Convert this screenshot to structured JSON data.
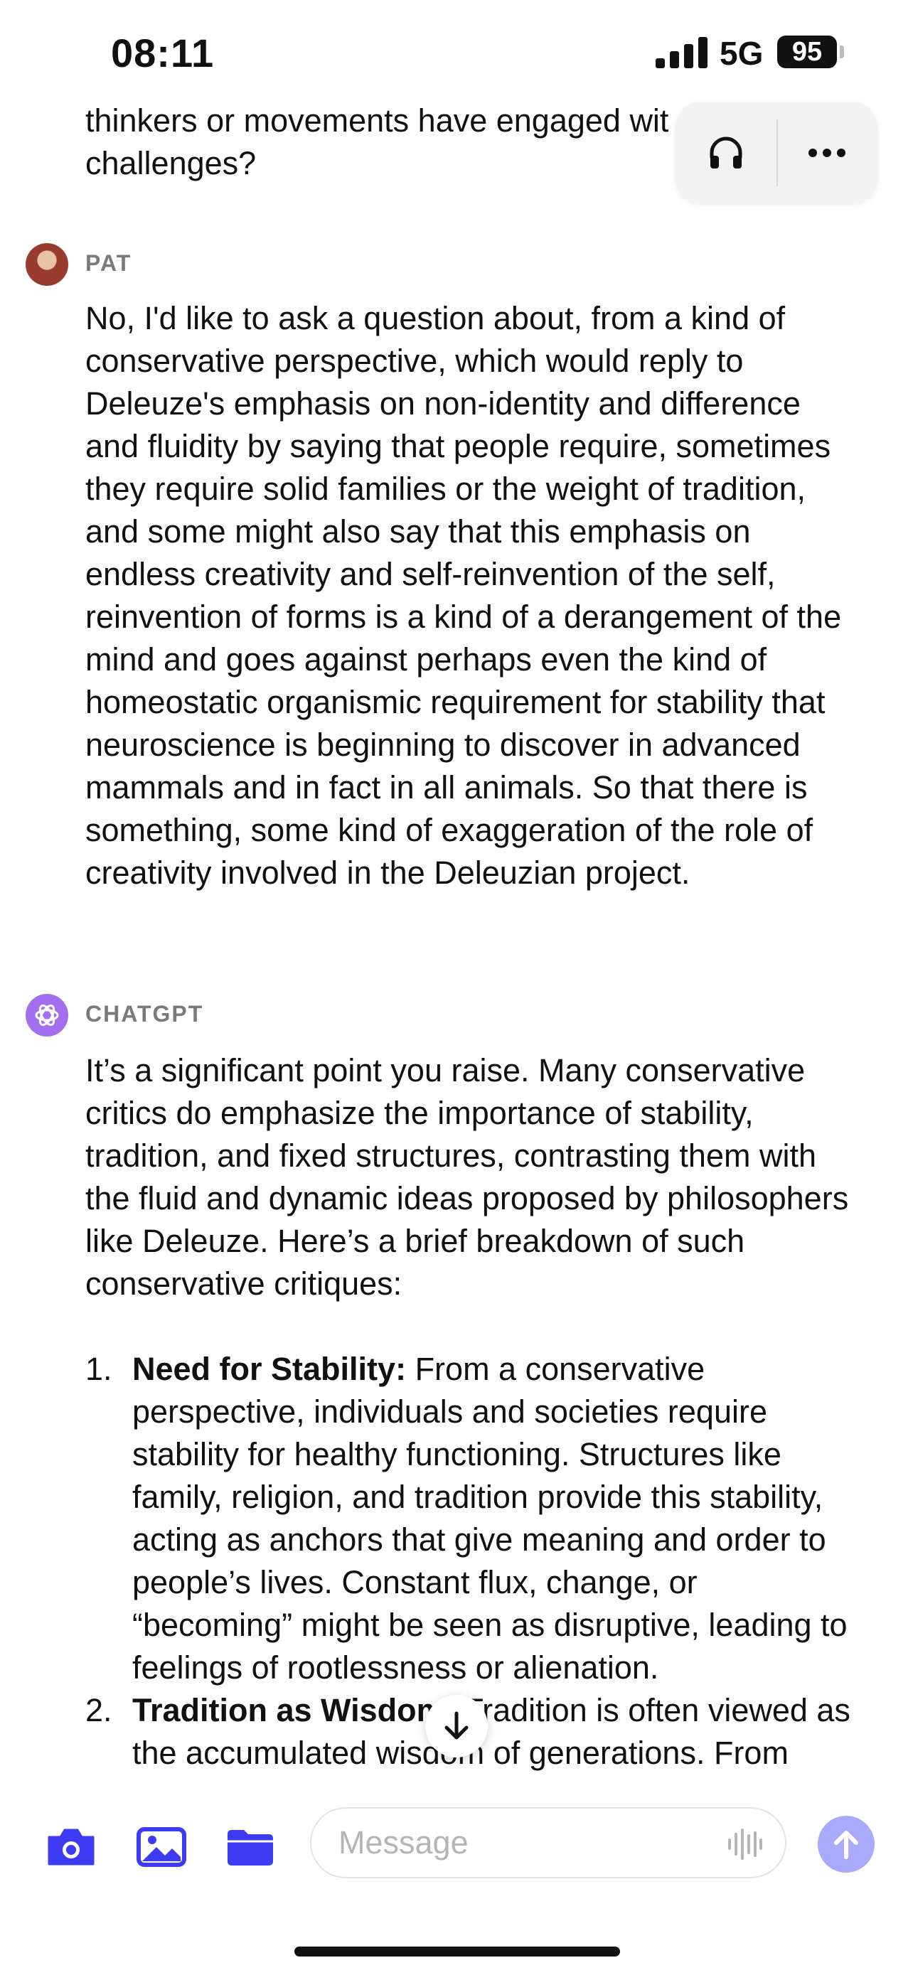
{
  "status_bar": {
    "time": "08:11",
    "network": "5G",
    "battery": "95"
  },
  "previous_message_tail": {
    "line1": "thinkers or movements have engaged wit",
    "line2": "challenges?"
  },
  "toolbar": {
    "headphones_icon": "headphones-icon",
    "more_icon": "more-horizontal-icon"
  },
  "conversation": [
    {
      "speaker": "PAT",
      "avatar": "user-avatar",
      "text": "No, I'd like to ask a question about, from a kind of conservative perspective, which would reply to Deleuze's emphasis on non-identity and difference and fluidity by saying that people require, sometimes they require solid families or the weight of tradition, and some might also say that this emphasis on endless creativity and self-reinvention of the self, reinvention of forms is a kind of a derangement of the mind and goes against perhaps even the kind of homeostatic organismic requirement for stability that neuroscience is beginning to discover in advanced mammals and in fact in all animals. So that there is something, some kind of exaggeration of the role of creativity involved in the Deleuzian project."
    },
    {
      "speaker": "CHATGPT",
      "avatar": "chatgpt-logo-icon",
      "intro": "It’s a significant point you raise. Many conservative critics do emphasize the importance of stability, tradition, and fixed structures, contrasting them with the fluid and dynamic ideas proposed by philosophers like Deleuze. Here’s a brief breakdown of such conservative critiques:",
      "points": [
        {
          "number": "1.",
          "title": "Need for Stability:",
          "text": " From a conservative perspective, individuals and societies require stability for healthy functioning. Structures like family, religion, and tradition provide this stability, acting as anchors that give meaning and order to people’s lives. Constant flux, change, or “becoming” might be seen as disruptive, leading to feelings of rootlessness or alienation."
        },
        {
          "number": "2.",
          "title": "Tradition as Wisdom:",
          "text": " Tradition is often viewed as the accumulated wisdom of generations. From"
        }
      ]
    }
  ],
  "composer": {
    "placeholder": "Message",
    "camera_icon": "camera-icon",
    "photo_icon": "photo-icon",
    "folder_icon": "folder-icon",
    "voice_icon": "voice-waveform-icon",
    "send_icon": "send-arrow-icon",
    "scroll_icon": "arrow-down-icon"
  },
  "colors": {
    "accent": "#3d3cf2",
    "send_disabled": "#a9aafc",
    "speaker_label": "#7a7a7a",
    "chatgpt_avatar": "#a36ff0"
  }
}
